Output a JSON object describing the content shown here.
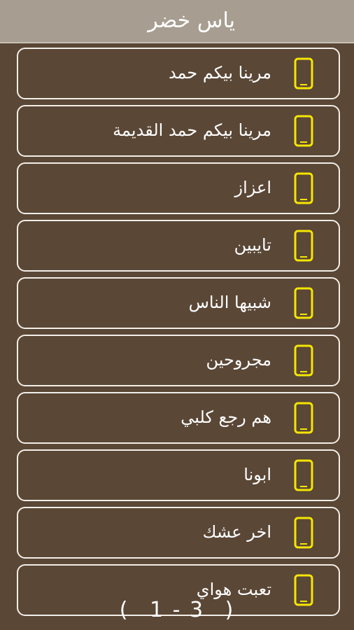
{
  "header": {
    "title": "ياس خضر"
  },
  "list": {
    "items": [
      {
        "label": "مرينا بيكم حمد",
        "icon": "phone-icon"
      },
      {
        "label": "مرينا بيكم حمد القديمة",
        "icon": "phone-icon"
      },
      {
        "label": "اعزاز",
        "icon": "phone-icon"
      },
      {
        "label": "تايبين",
        "icon": "phone-icon"
      },
      {
        "label": "شبيها الناس",
        "icon": "phone-icon"
      },
      {
        "label": "مجروحين",
        "icon": "phone-icon"
      },
      {
        "label": "هم رجع كلبي",
        "icon": "phone-icon"
      },
      {
        "label": "ابونا",
        "icon": "phone-icon"
      },
      {
        "label": "اخر عشك",
        "icon": "phone-icon"
      },
      {
        "label": "تعبت هواي",
        "icon": "phone-icon"
      }
    ]
  },
  "pager": {
    "open": "(",
    "page": "1 - 3",
    "close": ")"
  },
  "colors": {
    "background": "#5a4736",
    "header": "#a79d90",
    "border": "#f2eee8",
    "icon": "#f5e600"
  }
}
